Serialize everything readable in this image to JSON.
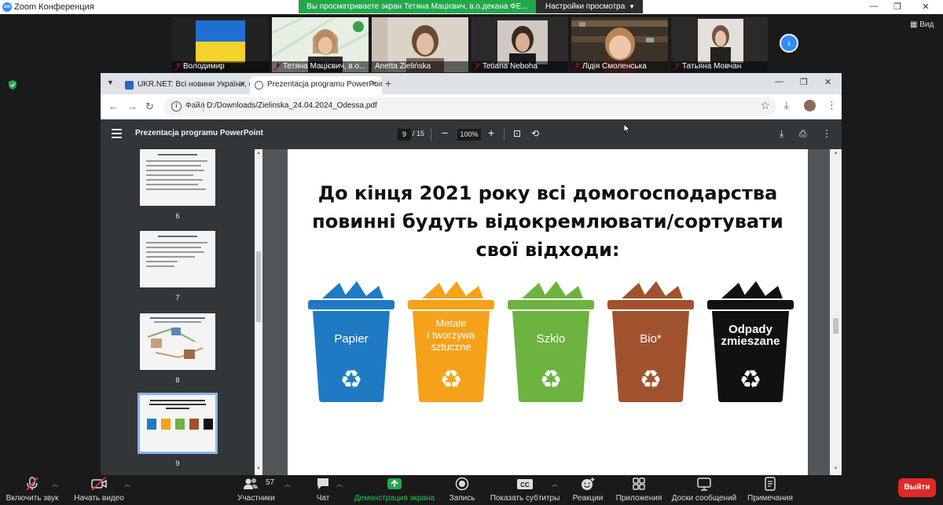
{
  "zoom": {
    "window_title": "Zoom Конференция",
    "logo_text": "zm",
    "share_banner": "Вы просматриваете экран Тетяна Мацієвич, в.о.декана ФЕ...",
    "view_settings": "Настройки просмотра",
    "view_button": "Вид"
  },
  "participants": [
    {
      "name": "Володимир"
    },
    {
      "name": "Тетяна Мацієвич, в.о..."
    },
    {
      "name": "Anetta Zielińska"
    },
    {
      "name": "Tetiana Neboha"
    },
    {
      "name": "Лідія Смоленська"
    },
    {
      "name": "Татьяна Мовчан"
    }
  ],
  "browser": {
    "tabs": [
      {
        "label": "UKR.NET: Всі новини України, ос..."
      },
      {
        "label": "Prezentacja programu PowerPoint"
      }
    ],
    "url_scheme_label": "Файл",
    "url": "D:/Downloads/Zielinska_24.04.2024_Odessa.pdf"
  },
  "pdf": {
    "title": "Prezentacja programu PowerPoint",
    "current_page": "9",
    "total_pages": "/ 15",
    "zoom": "100%",
    "thumbnails": [
      {
        "num": "6"
      },
      {
        "num": "7"
      },
      {
        "num": "8"
      },
      {
        "num": "9"
      }
    ],
    "slide": {
      "title_lines": [
        "До кінця 2021 року всі домогосподарства",
        "повинні будуть відокремлювати/сортувати",
        "свої відходи:"
      ],
      "bins": [
        {
          "label": [
            "Papier"
          ],
          "color": "#1f7ac4",
          "lid": "#1f7ac4"
        },
        {
          "label": [
            "Metale",
            "i tworzywa",
            "sztuczne"
          ],
          "color": "#f5a11a",
          "lid": "#f5a11a"
        },
        {
          "label": [
            "Szklo"
          ],
          "color": "#6cb33f",
          "lid": "#6cb33f"
        },
        {
          "label": [
            "Bio*"
          ],
          "color": "#a0522d",
          "lid": "#a0522d"
        },
        {
          "label": [
            "Odpady",
            "zmieszane"
          ],
          "color": "#111111",
          "lid": "#111111"
        }
      ]
    }
  },
  "bottom_bar": {
    "mute": "Включить звук",
    "video": "Начать видео",
    "participants": "Участники",
    "participants_count": "57",
    "chat": "Чат",
    "share": "Демонстрация экрана",
    "record": "Запись",
    "captions": "Показать субтитры",
    "captions_badge": "CC",
    "reactions": "Реакции",
    "apps": "Приложения",
    "whiteboards": "Доски сообщений",
    "notes": "Примечания",
    "leave": "Выйти"
  },
  "colors": {
    "zoom_green": "#22a74b",
    "zoom_blue": "#2d8cff",
    "leave_red": "#e02828",
    "pdf_toolbar": "#323639"
  }
}
